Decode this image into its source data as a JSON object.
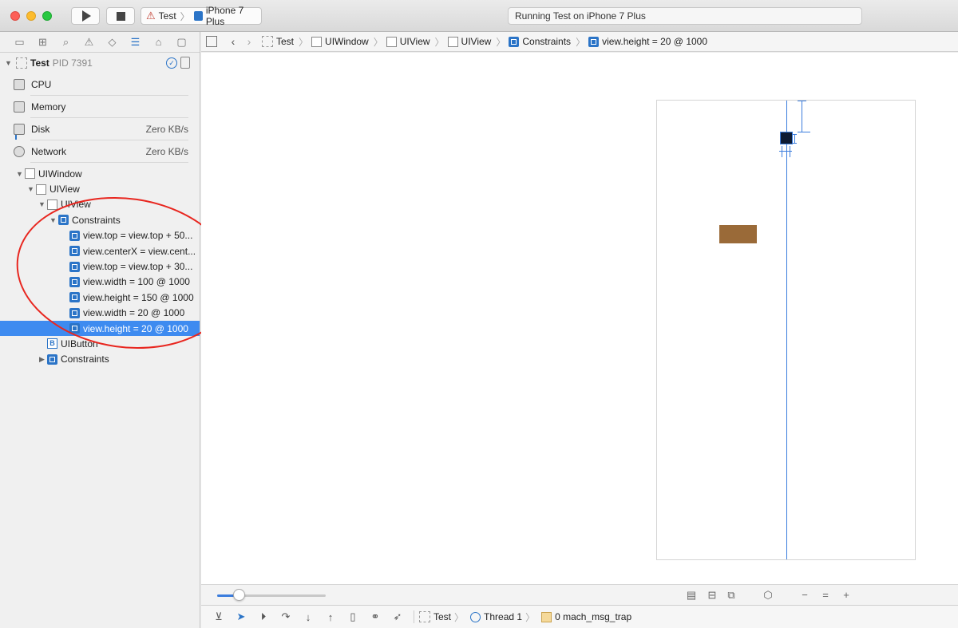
{
  "toolbar": {
    "scheme_app": "Test",
    "scheme_device": "iPhone 7 Plus",
    "activity_text": "Running Test on iPhone 7 Plus"
  },
  "navigator": {
    "tabs": [
      "folder-icon",
      "hierarchy-icon",
      "search-icon",
      "warning-icon",
      "breakpoint-diamond-icon",
      "debug-list-icon",
      "tag-icon",
      "report-icon"
    ],
    "active_tab_index": 5,
    "process": {
      "name": "Test",
      "pid": "PID 7391"
    },
    "gauges": [
      {
        "label": "CPU",
        "value": ""
      },
      {
        "label": "Memory",
        "value": ""
      },
      {
        "label": "Disk",
        "value": "Zero KB/s"
      },
      {
        "label": "Network",
        "value": "Zero KB/s"
      }
    ],
    "tree": [
      {
        "label": "UIWindow",
        "kind": "view",
        "depth": 0,
        "disclosure": "open"
      },
      {
        "label": "UIView",
        "kind": "view",
        "depth": 1,
        "disclosure": "open"
      },
      {
        "label": "UIView",
        "kind": "view",
        "depth": 2,
        "disclosure": "open"
      },
      {
        "label": "Constraints",
        "kind": "constraints",
        "depth": 3,
        "disclosure": "open"
      },
      {
        "label": "view.top = view.top + 50...",
        "kind": "constraint",
        "depth": 4,
        "disclosure": "none"
      },
      {
        "label": "view.centerX = view.cent...",
        "kind": "constraint",
        "depth": 4,
        "disclosure": "none"
      },
      {
        "label": "view.top = view.top + 30...",
        "kind": "constraint",
        "depth": 4,
        "disclosure": "none"
      },
      {
        "label": "view.width = 100 @ 1000",
        "kind": "constraint",
        "depth": 4,
        "disclosure": "none"
      },
      {
        "label": "view.height = 150 @ 1000",
        "kind": "constraint",
        "depth": 4,
        "disclosure": "none"
      },
      {
        "label": "view.width = 20 @ 1000",
        "kind": "constraint",
        "depth": 4,
        "disclosure": "none"
      },
      {
        "label": "view.height = 20 @ 1000",
        "kind": "constraint",
        "depth": 4,
        "disclosure": "none",
        "selected": true
      },
      {
        "label": "UIButton",
        "kind": "button",
        "depth": 2,
        "disclosure": "none"
      },
      {
        "label": "Constraints",
        "kind": "constraints",
        "depth": 2,
        "disclosure": "closed"
      }
    ]
  },
  "jumpbar": {
    "crumbs": [
      {
        "label": "Test",
        "icon": "app"
      },
      {
        "label": "UIWindow",
        "icon": "view"
      },
      {
        "label": "UIView",
        "icon": "view"
      },
      {
        "label": "UIView",
        "icon": "view"
      },
      {
        "label": "Constraints",
        "icon": "constraints"
      },
      {
        "label": "view.height = 20 @ 1000",
        "icon": "constraint"
      }
    ]
  },
  "canvas": {
    "zoom_level": 0.2,
    "annotation_color": "#e8261f",
    "accent_color": "#3b7ddd",
    "view_color": "#9a6a38"
  },
  "debugbar": {
    "process": "Test",
    "thread": "Thread 1",
    "frame": "0 mach_msg_trap"
  }
}
